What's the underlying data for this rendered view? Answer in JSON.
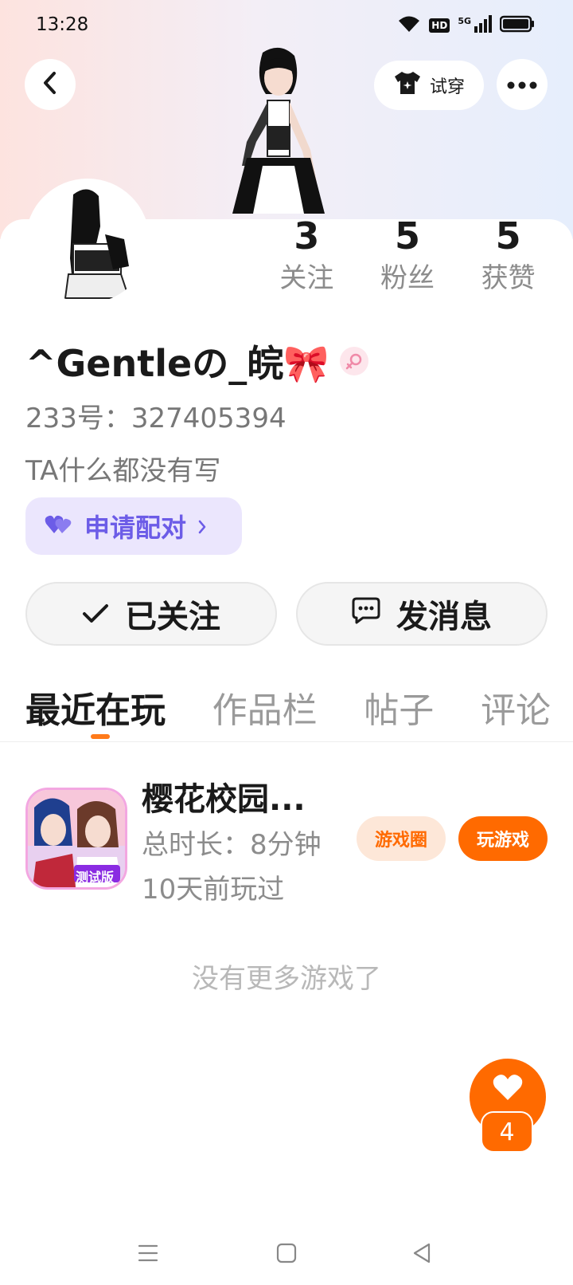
{
  "status_bar": {
    "time": "13:28",
    "hd": "HD",
    "network": "5G"
  },
  "header": {
    "try_on_label": "试穿"
  },
  "stats": [
    {
      "value": "3",
      "label": "关注"
    },
    {
      "value": "5",
      "label": "粉丝"
    },
    {
      "value": "5",
      "label": "获赞"
    }
  ],
  "profile": {
    "nickname": "^Gentleの_皖🎀",
    "uid_text": "233号：327405394",
    "bio": "TA什么都没有写"
  },
  "pair_button": {
    "label": "申请配对"
  },
  "actions": {
    "follow_label": "已关注",
    "message_label": "发消息"
  },
  "tabs": [
    {
      "label": "最近在玩",
      "active": true
    },
    {
      "label": "作品栏",
      "active": false
    },
    {
      "label": "帖子",
      "active": false
    },
    {
      "label": "评论",
      "active": false
    }
  ],
  "games": [
    {
      "title": "樱花校园...",
      "duration": "总时长：8分钟",
      "last_played": "10天前玩过",
      "icon_badge": "测试版",
      "circle_label": "游戏圈",
      "play_label": "玩游戏"
    }
  ],
  "no_more_text": "没有更多游戏了",
  "fab": {
    "count": "4"
  },
  "colors": {
    "accent": "#ff6a00",
    "pair": "#6c5ce7"
  }
}
